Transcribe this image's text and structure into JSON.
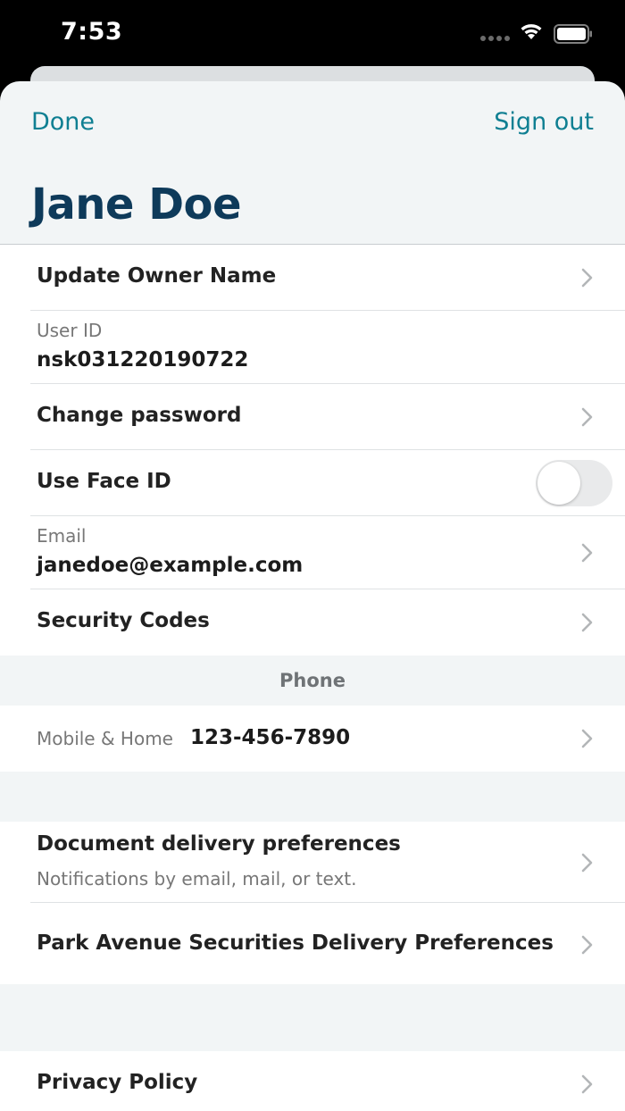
{
  "status": {
    "time": "7:53"
  },
  "nav": {
    "done": "Done",
    "sign_out": "Sign out"
  },
  "profile": {
    "name": "Jane Doe"
  },
  "account": {
    "update_owner_name": "Update Owner Name",
    "user_id_label": "User ID",
    "user_id_value": "nsk031220190722",
    "change_password": "Change password",
    "face_id_label": "Use Face ID",
    "face_id_enabled": false,
    "email_label": "Email",
    "email_value": "janedoe@example.com",
    "security_codes": "Security Codes"
  },
  "phone": {
    "section_title": "Phone",
    "label": "Mobile & Home",
    "value": "123-456-7890"
  },
  "delivery": {
    "doc_pref_label": "Document delivery preferences",
    "doc_pref_sub": "Notifications by email, mail, or text.",
    "park_avenue": "Park Avenue Securities Delivery Preferences"
  },
  "legal": {
    "privacy_policy": "Privacy Policy"
  },
  "colors": {
    "accent": "#0f7f92",
    "title": "#0e3a5a",
    "sheet_bg": "#f2f5f6"
  }
}
